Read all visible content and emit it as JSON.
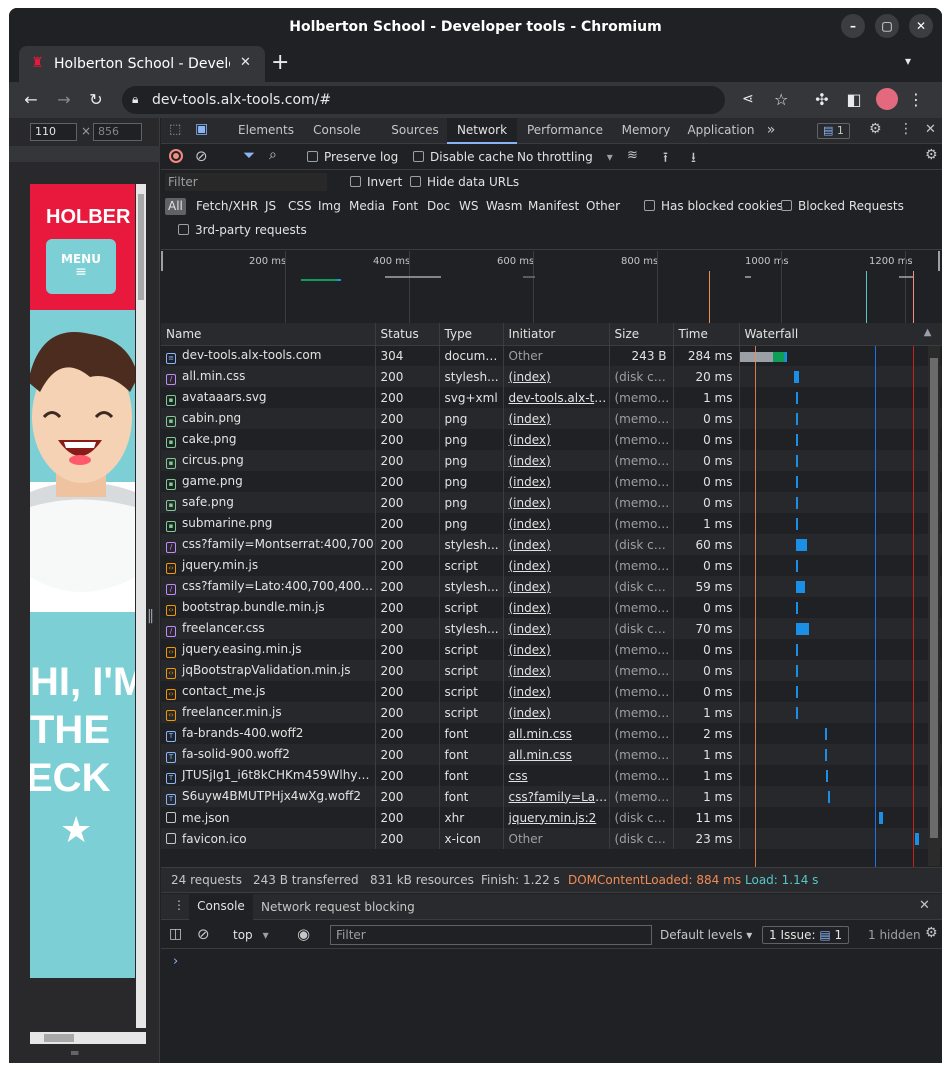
{
  "window": {
    "title": "Holberton School - Developer tools - Chromium"
  },
  "tab": {
    "title": "Holberton School - Develo",
    "new_tab": "+"
  },
  "omnibox": {
    "url": "dev-tools.alx-tools.com/#"
  },
  "viewport": {
    "width": "110",
    "times": "×",
    "height": "856"
  },
  "page_preview": {
    "brand": "HOLBER",
    "menu_label": "MENU",
    "menu_glyph": "≡",
    "hero_lines": [
      "HI, I'M",
      "THE",
      "ECK"
    ],
    "star": "★"
  },
  "devtools": {
    "tabs": [
      "Elements",
      "Console",
      "Sources",
      "Network",
      "Performance",
      "Memory",
      "Application"
    ],
    "active_tab": "Network",
    "more": "»",
    "issues_badge": "1",
    "toolbar": {
      "preserve_log": "Preserve log",
      "disable_cache": "Disable cache",
      "throttling": "No throttling"
    },
    "filter": {
      "placeholder": "Filter",
      "invert": "Invert",
      "hide_data_urls": "Hide data URLs"
    },
    "type_filters": [
      "All",
      "Fetch/XHR",
      "JS",
      "CSS",
      "Img",
      "Media",
      "Font",
      "Doc",
      "WS",
      "Wasm",
      "Manifest",
      "Other"
    ],
    "has_blocked_cookies": "Has blocked cookies",
    "blocked_requests": "Blocked Requests",
    "third_party": "3rd-party requests",
    "overview_ticks": [
      "200 ms",
      "400 ms",
      "600 ms",
      "800 ms",
      "1000 ms",
      "1200 ms"
    ],
    "columns": [
      "Name",
      "Status",
      "Type",
      "Initiator",
      "Size",
      "Time",
      "Waterfall"
    ],
    "requests": [
      {
        "name": "dev-tools.alx-tools.com",
        "status": "304",
        "type": "document",
        "initiator": "Other",
        "size": "243 B",
        "time": "284 ms",
        "icon": "doc",
        "wf_start": 0.0,
        "wf_len": 0.26
      },
      {
        "name": "all.min.css",
        "status": "200",
        "type": "stylesh...",
        "initiator": "(index)",
        "size": "(disk ca...",
        "time": "20 ms",
        "icon": "css",
        "wf_start": 0.3,
        "wf_len": 0.03
      },
      {
        "name": "avataaars.svg",
        "status": "200",
        "type": "svg+xml",
        "initiator": "dev-tools.alx-to...",
        "size": "(memor...",
        "time": "1 ms",
        "icon": "img",
        "wf_start": 0.31,
        "wf_len": 0.01
      },
      {
        "name": "cabin.png",
        "status": "200",
        "type": "png",
        "initiator": "(index)",
        "size": "(memor...",
        "time": "0 ms",
        "icon": "img",
        "wf_start": 0.31,
        "wf_len": 0.01
      },
      {
        "name": "cake.png",
        "status": "200",
        "type": "png",
        "initiator": "(index)",
        "size": "(memor...",
        "time": "0 ms",
        "icon": "img",
        "wf_start": 0.31,
        "wf_len": 0.01
      },
      {
        "name": "circus.png",
        "status": "200",
        "type": "png",
        "initiator": "(index)",
        "size": "(memor...",
        "time": "0 ms",
        "icon": "img",
        "wf_start": 0.31,
        "wf_len": 0.01
      },
      {
        "name": "game.png",
        "status": "200",
        "type": "png",
        "initiator": "(index)",
        "size": "(memor...",
        "time": "0 ms",
        "icon": "img",
        "wf_start": 0.31,
        "wf_len": 0.01
      },
      {
        "name": "safe.png",
        "status": "200",
        "type": "png",
        "initiator": "(index)",
        "size": "(memor...",
        "time": "0 ms",
        "icon": "img",
        "wf_start": 0.31,
        "wf_len": 0.01
      },
      {
        "name": "submarine.png",
        "status": "200",
        "type": "png",
        "initiator": "(index)",
        "size": "(memor...",
        "time": "1 ms",
        "icon": "img",
        "wf_start": 0.31,
        "wf_len": 0.01
      },
      {
        "name": "css?family=Montserrat:400,700",
        "status": "200",
        "type": "stylesh...",
        "initiator": "(index)",
        "size": "(disk ca...",
        "time": "60 ms",
        "icon": "css",
        "wf_start": 0.31,
        "wf_len": 0.06
      },
      {
        "name": "jquery.min.js",
        "status": "200",
        "type": "script",
        "initiator": "(index)",
        "size": "(memor...",
        "time": "0 ms",
        "icon": "js",
        "wf_start": 0.31,
        "wf_len": 0.01
      },
      {
        "name": "css?family=Lato:400,700,400ital...",
        "status": "200",
        "type": "stylesh...",
        "initiator": "(index)",
        "size": "(disk ca...",
        "time": "59 ms",
        "icon": "css",
        "wf_start": 0.31,
        "wf_len": 0.05
      },
      {
        "name": "bootstrap.bundle.min.js",
        "status": "200",
        "type": "script",
        "initiator": "(index)",
        "size": "(memor...",
        "time": "0 ms",
        "icon": "js",
        "wf_start": 0.31,
        "wf_len": 0.01
      },
      {
        "name": "freelancer.css",
        "status": "200",
        "type": "stylesh...",
        "initiator": "(index)",
        "size": "(disk ca...",
        "time": "70 ms",
        "icon": "css",
        "wf_start": 0.31,
        "wf_len": 0.07
      },
      {
        "name": "jquery.easing.min.js",
        "status": "200",
        "type": "script",
        "initiator": "(index)",
        "size": "(memor...",
        "time": "0 ms",
        "icon": "js",
        "wf_start": 0.31,
        "wf_len": 0.01
      },
      {
        "name": "jqBootstrapValidation.min.js",
        "status": "200",
        "type": "script",
        "initiator": "(index)",
        "size": "(memor...",
        "time": "0 ms",
        "icon": "js",
        "wf_start": 0.31,
        "wf_len": 0.01
      },
      {
        "name": "contact_me.js",
        "status": "200",
        "type": "script",
        "initiator": "(index)",
        "size": "(memor...",
        "time": "0 ms",
        "icon": "js",
        "wf_start": 0.31,
        "wf_len": 0.01
      },
      {
        "name": "freelancer.min.js",
        "status": "200",
        "type": "script",
        "initiator": "(index)",
        "size": "(memor...",
        "time": "1 ms",
        "icon": "js",
        "wf_start": 0.31,
        "wf_len": 0.01
      },
      {
        "name": "fa-brands-400.woff2",
        "status": "200",
        "type": "font",
        "initiator": "all.min.css",
        "size": "(memor...",
        "time": "2 ms",
        "icon": "font",
        "wf_start": 0.47,
        "wf_len": 0.01
      },
      {
        "name": "fa-solid-900.woff2",
        "status": "200",
        "type": "font",
        "initiator": "all.min.css",
        "size": "(memor...",
        "time": "1 ms",
        "icon": "font",
        "wf_start": 0.47,
        "wf_len": 0.01
      },
      {
        "name": "JTUSjIg1_i6t8kCHKm459Wlhyw...",
        "status": "200",
        "type": "font",
        "initiator": "css",
        "size": "(memor...",
        "time": "1 ms",
        "icon": "font",
        "wf_start": 0.48,
        "wf_len": 0.01
      },
      {
        "name": "S6uyw4BMUTPHjx4wXg.woff2",
        "status": "200",
        "type": "font",
        "initiator": "css?family=Lat...",
        "size": "(memor...",
        "time": "1 ms",
        "icon": "font",
        "wf_start": 0.49,
        "wf_len": 0.01
      },
      {
        "name": "me.json",
        "status": "200",
        "type": "xhr",
        "initiator": "jquery.min.js:2",
        "size": "(disk ca...",
        "time": "11 ms",
        "icon": "file",
        "wf_start": 0.77,
        "wf_len": 0.02
      },
      {
        "name": "favicon.ico",
        "status": "200",
        "type": "x-icon",
        "initiator": "Other",
        "size": "(disk ca...",
        "time": "23 ms",
        "icon": "file",
        "wf_start": 0.97,
        "wf_len": 0.02
      }
    ],
    "status_bar": {
      "requests": "24 requests",
      "transferred": "243 B transferred",
      "resources": "831 kB resources",
      "finish": "Finish: 1.22 s",
      "dcl": "DOMContentLoaded: 884 ms",
      "load": "Load: 1.14 s"
    },
    "drawer": {
      "tabs": [
        "Console",
        "Network request blocking"
      ],
      "context": "top",
      "filter_placeholder": "Filter",
      "levels": "Default levels",
      "issues": "1 Issue:",
      "issues_count": "1",
      "hidden": "1 hidden",
      "prompt": "›"
    }
  },
  "colors": {
    "dcl": "#f28b54",
    "load": "#56c6c6",
    "blue_bar": "#1a8fe5",
    "green_bar": "#0f9d58",
    "brand_red": "#e8193c",
    "teal": "#7ccfd4"
  }
}
